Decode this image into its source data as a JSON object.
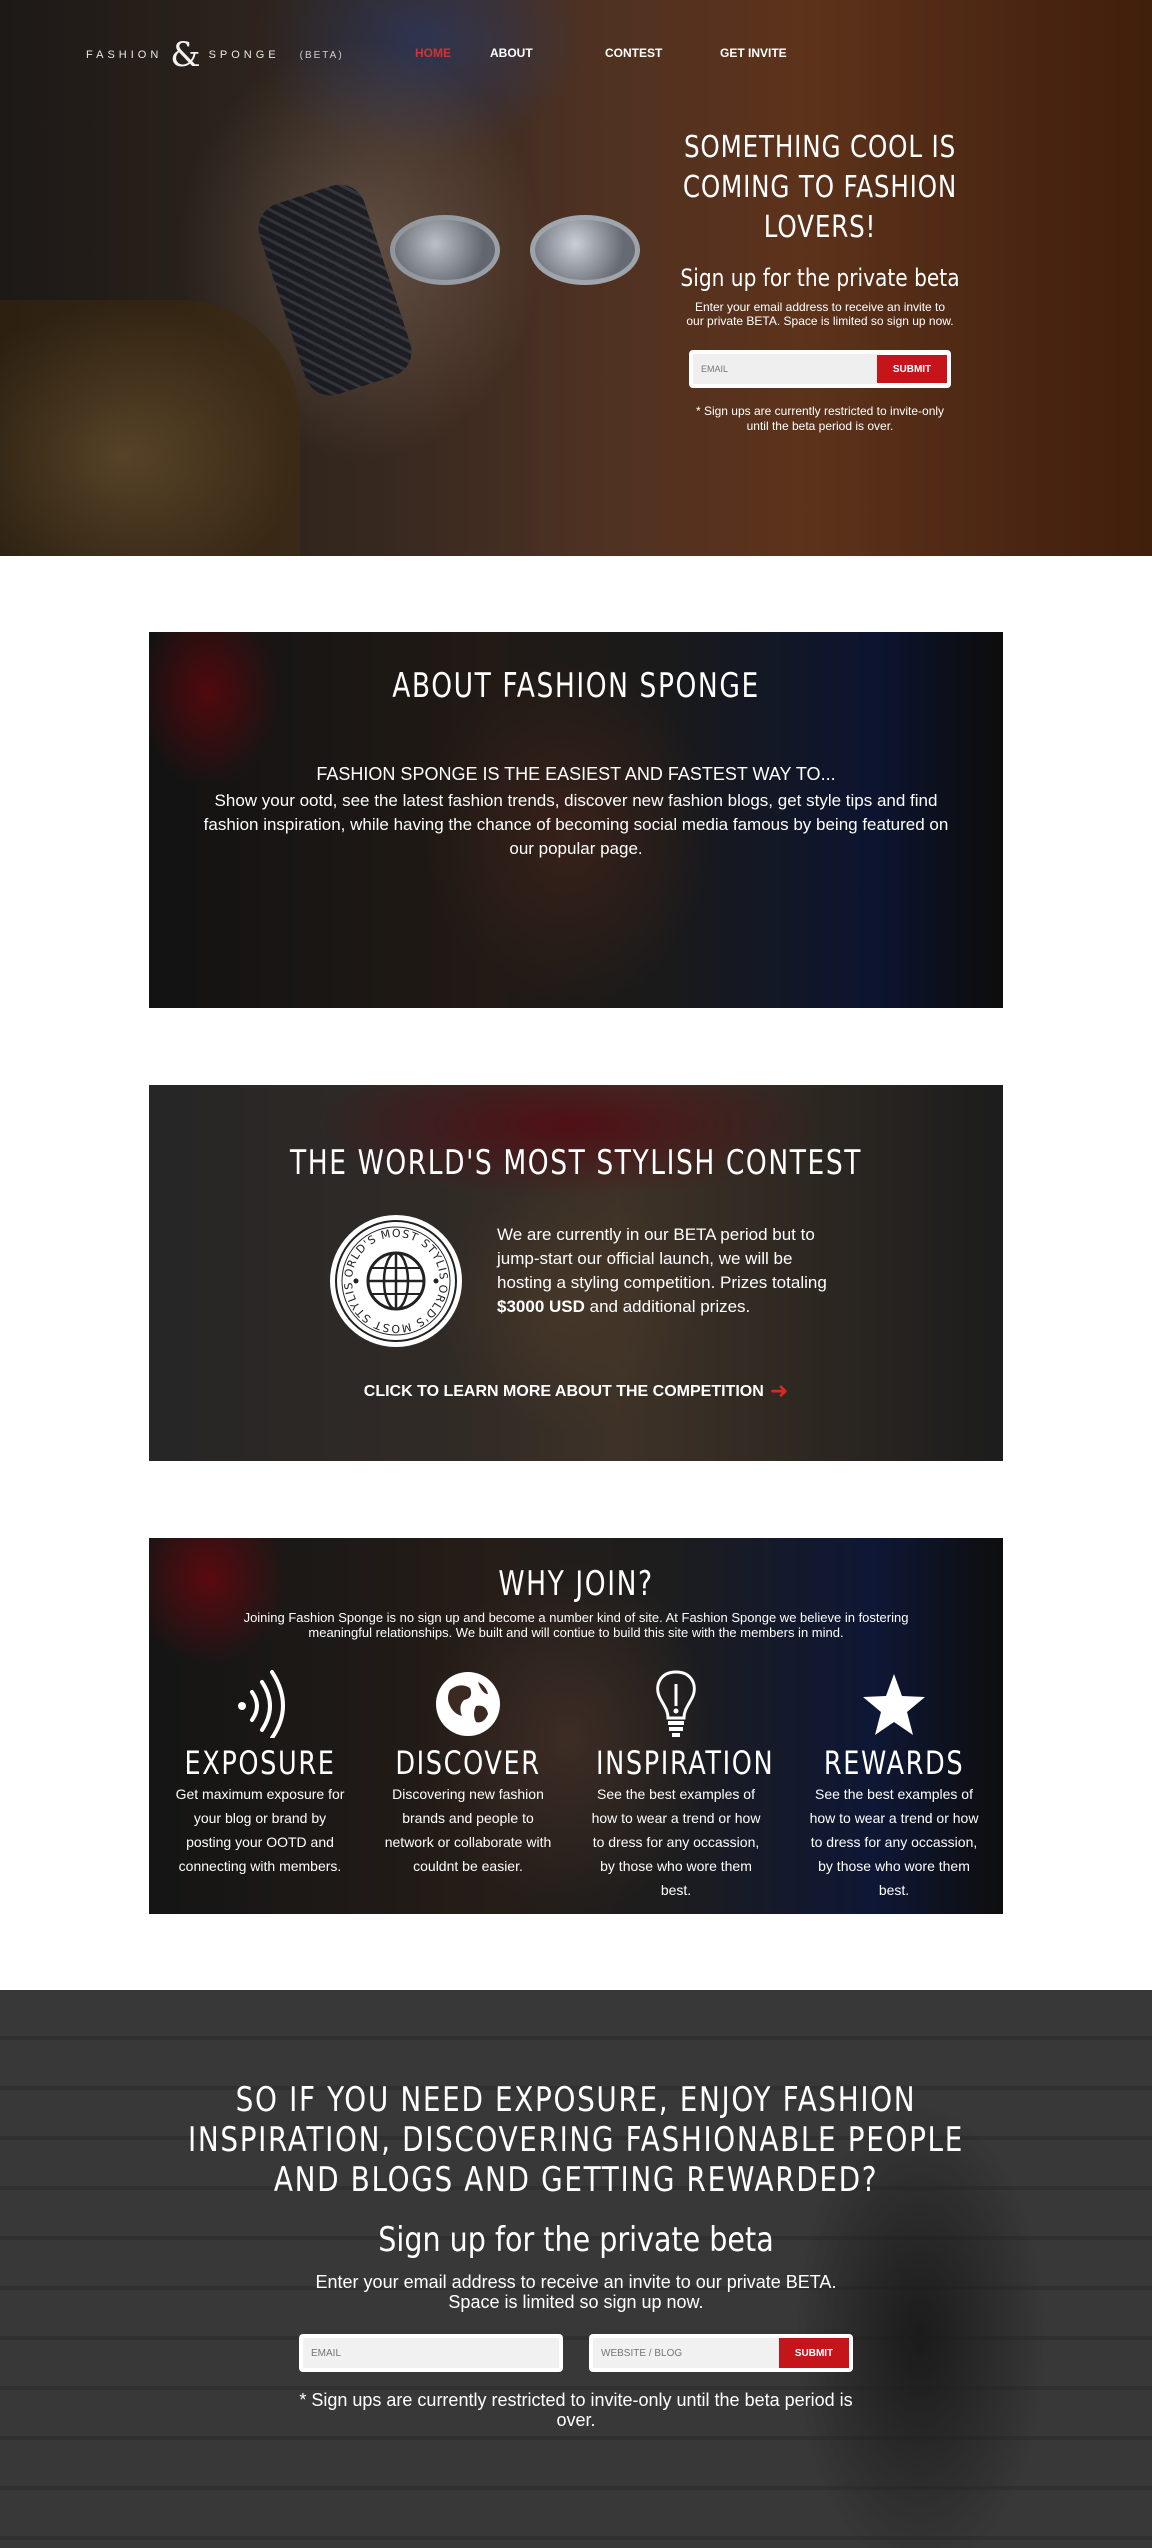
{
  "brand": {
    "logo_left": "FASHION",
    "logo_mark": "&",
    "logo_right": "SPONGE",
    "logo_tag": "(BETA)",
    "accent": "#c5141a"
  },
  "nav": {
    "items": [
      {
        "label": "HOME",
        "active": true
      },
      {
        "label": "ABOUT",
        "active": false
      },
      {
        "label": "CONTEST",
        "active": false
      },
      {
        "label": "GET INVITE",
        "active": false
      }
    ]
  },
  "hero": {
    "headline": "SOMETHING COOL IS COMING TO FASHION LOVERS!",
    "subheadline": "Sign up for the private beta",
    "lead": "Enter your email address to receive an invite to our private BETA. Space is limited so sign up now.",
    "email_placeholder": "EMAIL",
    "submit_label": "SUBMIT",
    "note": "* Sign ups are currently restricted to invite-only until the beta period is over."
  },
  "about": {
    "title": "ABOUT FASHION SPONGE",
    "tagline": "FASHION SPONGE IS THE EASIEST AND FASTEST WAY TO...",
    "description": "Show your ootd, see the latest fashion trends, discover new fashion blogs, get style tips and find fashion inspiration, while having the chance of becoming social media famous by being featured on our popular page."
  },
  "contest": {
    "title": "THE WORLD'S MOST STYLISH CONTEST",
    "badge_text": "WORLD'S MOST STYLISH",
    "body_before": "We are currently in our BETA period but to jump-start our official launch, we will be hosting a styling competition. Prizes totaling ",
    "body_bold": "$3000 USD",
    "body_after": " and additional prizes.",
    "cta": "CLICK TO LEARN MORE ABOUT THE COMPETITION",
    "cta_icon": "arrow-right-icon"
  },
  "why": {
    "title": "WHY JOIN?",
    "intro": "Joining Fashion Sponge is no sign up and become a number kind of site. At Fashion Sponge we believe in fostering meaningful relationships. We built and will contiue to build this site with the members in mind.",
    "features": [
      {
        "icon": "signal-waves-icon",
        "title": "EXPOSURE",
        "text": "Get maximum exposure for your blog or brand by posting your OOTD and connecting with members."
      },
      {
        "icon": "globe-icon",
        "title": "DISCOVER",
        "text": "Discovering new fashion brands and people to network or collaborate with couldnt be easier."
      },
      {
        "icon": "lightbulb-icon",
        "title": "INSPIRATION",
        "text": "See the best examples of how to wear a trend or how to dress for any occassion, by those who wore them best."
      },
      {
        "icon": "star-icon",
        "title": "REWARDS",
        "text": "See the best examples of how to wear a trend or how to dress for any occassion, by those who wore them best."
      }
    ]
  },
  "footer_signup": {
    "headline": "SO IF YOU NEED EXPOSURE, ENJOY FASHION INSPIRATION, DISCOVERING FASHIONABLE PEOPLE AND BLOGS AND GETTING REWARDED?",
    "subheadline": "Sign up for the private beta",
    "lead": "Enter your email address to receive an invite to our private BETA. Space is limited so sign up now.",
    "email_placeholder": "EMAIL",
    "website_placeholder": "WEBSITE / BLOG",
    "submit_label": "SUBMIT",
    "note": "* Sign ups are currently restricted to invite-only until the beta period is over."
  }
}
